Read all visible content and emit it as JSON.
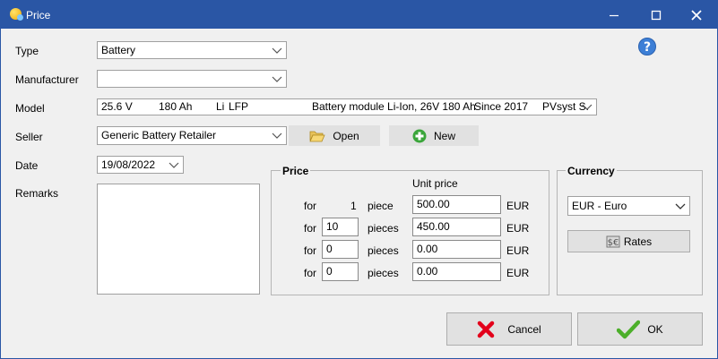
{
  "window": {
    "title": "Price"
  },
  "form": {
    "type_label": "Type",
    "type_value": "Battery",
    "manufacturer_label": "Manufacturer",
    "manufacturer_value": "",
    "model_label": "Model",
    "model_cols": [
      "25.6 V",
      "180 Ah",
      "Li",
      "LFP",
      "Battery module Li-Ion, 26V 180 Ah",
      "Since 2017",
      "PVsyst S."
    ],
    "seller_label": "Seller",
    "seller_value": "Generic Battery Retailer",
    "open_label": "Open",
    "new_label": "New",
    "date_label": "Date",
    "date_value": "19/08/2022",
    "remarks_label": "Remarks",
    "remarks_value": ""
  },
  "price": {
    "title": "Price",
    "unit_price_header": "Unit price",
    "rows": [
      {
        "for": "for",
        "qty": "1",
        "unit": "piece",
        "price": "500.00",
        "currency": "EUR"
      },
      {
        "for": "for",
        "qty": "10",
        "unit": "pieces",
        "price": "450.00",
        "currency": "EUR"
      },
      {
        "for": "for",
        "qty": "0",
        "unit": "pieces",
        "price": "0.00",
        "currency": "EUR"
      },
      {
        "for": "for",
        "qty": "0",
        "unit": "pieces",
        "price": "0.00",
        "currency": "EUR"
      }
    ]
  },
  "currency": {
    "title": "Currency",
    "selected": "EUR - Euro",
    "rates_label": "Rates"
  },
  "footer": {
    "cancel_label": "Cancel",
    "ok_label": "OK"
  },
  "colors": {
    "titlebar": "#2a56a5",
    "cancel_red": "#e3001b",
    "ok_green": "#4caf2a",
    "new_green": "#3aa53a",
    "help_blue": "#3d7fd6"
  }
}
